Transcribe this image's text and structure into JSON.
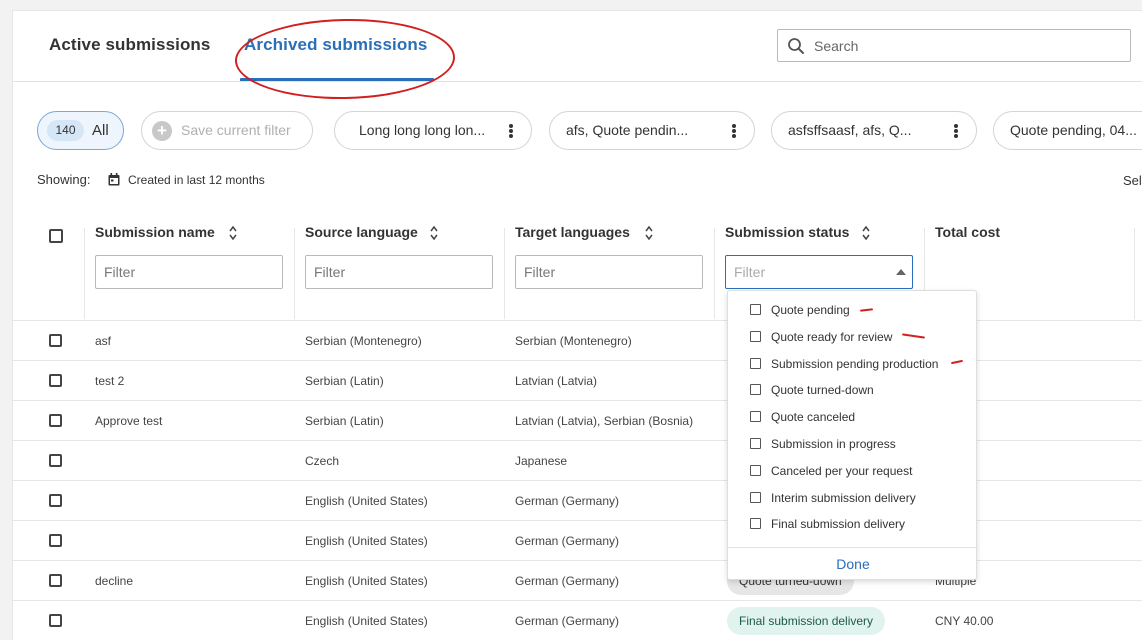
{
  "tabs": {
    "active": "Active submissions",
    "archived": "Archived submissions"
  },
  "search": {
    "placeholder": "Search"
  },
  "filters": {
    "all_count": "140",
    "all_label": "All",
    "save_label": "Save current filter",
    "saved": [
      "Long long long lon...",
      "afs, Quote pendin...",
      "asfsffsaasf, afs, Q...",
      "Quote pending, 04..."
    ]
  },
  "showing": {
    "label": "Showing:",
    "value": "Created in last 12 months",
    "select_partial": "Sel"
  },
  "columns": {
    "name": "Submission name",
    "source": "Source language",
    "target": "Target languages",
    "status": "Submission status",
    "cost": "Total cost",
    "filter_placeholder": "Filter"
  },
  "rows": [
    {
      "name": "asf",
      "source": "Serbian (Montenegro)",
      "target": "Serbian (Montenegro)",
      "status": "",
      "cost": "00"
    },
    {
      "name": "test 2",
      "source": "Serbian (Latin)",
      "target": "Latvian (Latvia)",
      "status": "",
      "cost": "26"
    },
    {
      "name": "Approve test",
      "source": "Serbian (Latin)",
      "target": "Latvian (Latvia), Serbian (Bosnia)",
      "status": "",
      "cost": "00"
    },
    {
      "name": "",
      "source": "Czech",
      "target": "Japanese",
      "status": "",
      "cost": "00"
    },
    {
      "name": "",
      "source": "English (United States)",
      "target": "German (Germany)",
      "status": "",
      "cost": "00"
    },
    {
      "name": "",
      "source": "English (United States)",
      "target": "German (Germany)",
      "status": "",
      "cost": "00"
    },
    {
      "name": "decline",
      "source": "English (United States)",
      "target": "German (Germany)",
      "status": "Quote turned-down",
      "cost": "Multiple"
    },
    {
      "name": "",
      "source": "English (United States)",
      "target": "German (Germany)",
      "status": "Final submission delivery",
      "cost": "CNY 40.00"
    }
  ],
  "status_dropdown": {
    "options": [
      "Quote pending",
      "Quote ready for review",
      "Submission pending production",
      "Quote turned-down",
      "Quote canceled",
      "Submission in progress",
      "Canceled per your request",
      "Interim submission delivery",
      "Final submission delivery"
    ],
    "done_label": "Done"
  },
  "colors": {
    "accent": "#2a6fb8",
    "annotation": "#d21f1f",
    "final_badge_bg": "#e0f3ee",
    "turned_badge_bg": "#e6e6e6"
  }
}
